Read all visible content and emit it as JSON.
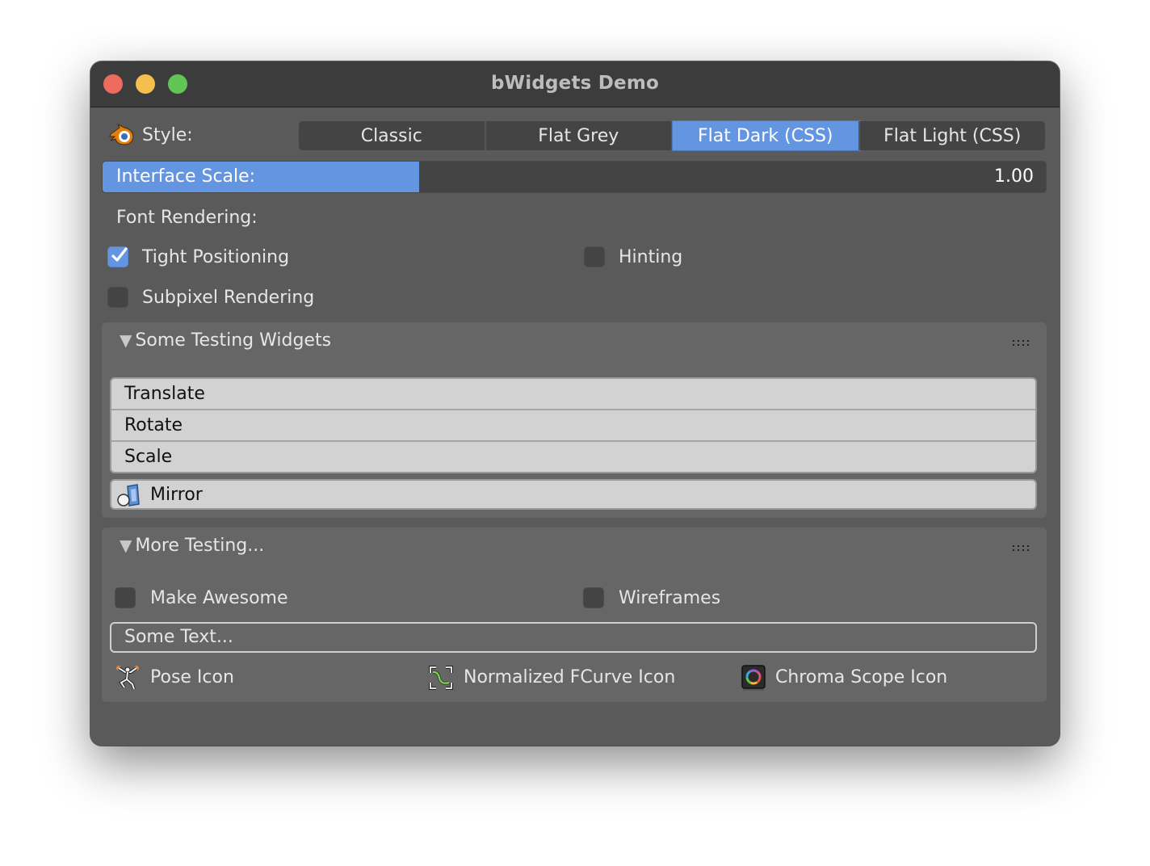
{
  "window": {
    "title": "bWidgets Demo",
    "traffic_lights": [
      "close",
      "minimize",
      "maximize"
    ]
  },
  "style_row": {
    "icon": "blender-logo-icon",
    "label": "Style:",
    "options": [
      {
        "label": "Classic",
        "active": false
      },
      {
        "label": "Flat Grey",
        "active": false
      },
      {
        "label": "Flat Dark (CSS)",
        "active": true
      },
      {
        "label": "Flat Light (CSS)",
        "active": false
      }
    ]
  },
  "interface_scale": {
    "label": "Interface Scale:",
    "value": "1.00",
    "fill_fraction": 0.336
  },
  "font_rendering": {
    "label": "Font Rendering:",
    "options": [
      {
        "label": "Tight Positioning",
        "checked": true
      },
      {
        "label": "Hinting",
        "checked": false
      },
      {
        "label": "Subpixel Rendering",
        "checked": false
      }
    ]
  },
  "panel1": {
    "title": "Some Testing Widgets",
    "expanded": true,
    "buttons": [
      "Translate",
      "Rotate",
      "Scale"
    ],
    "mirror": {
      "label": "Mirror",
      "icon": "mirror-icon"
    }
  },
  "panel2": {
    "title": "More Testing...",
    "expanded": true,
    "checkboxes": [
      {
        "label": "Make Awesome",
        "checked": false
      },
      {
        "label": "Wireframes",
        "checked": false
      }
    ],
    "text_field": {
      "value": "Some Text..."
    },
    "icon_labels": [
      {
        "label": "Pose Icon",
        "icon": "pose-icon"
      },
      {
        "label": "Normalized FCurve Icon",
        "icon": "normalized-fcurve-icon"
      },
      {
        "label": "Chroma Scope Icon",
        "icon": "chroma-scope-icon"
      }
    ]
  },
  "colors": {
    "accent": "#6495e1",
    "window_bg": "#5a5a5a",
    "panel_bg": "#666666",
    "widget_dark": "#444444",
    "button_light": "#d2d2d2",
    "titlebar": "#3c3c3c"
  }
}
